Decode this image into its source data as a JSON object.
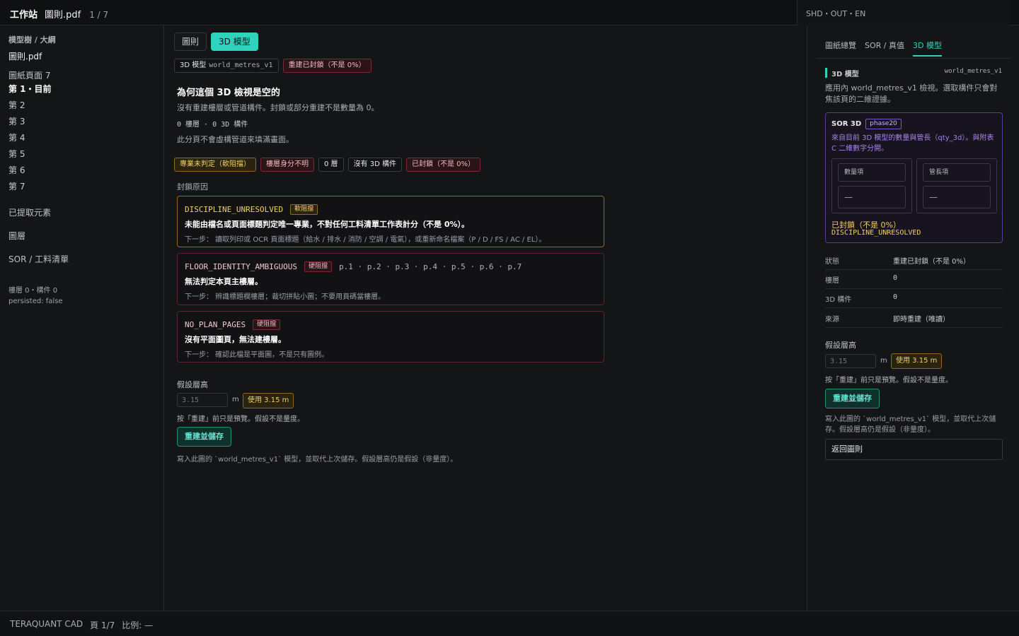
{
  "topbar": {
    "app": "工作站",
    "file": "圖則.pdf",
    "page": "1 / 7",
    "lang": "SHD・OUT・EN"
  },
  "sidebar": {
    "header": "模型樹 / 大綱",
    "file": "圖則.pdf",
    "pages_label": "圖紙頁面 7",
    "pages": [
      "第 1・目前",
      "第 2",
      "第 3",
      "第 4",
      "第 5",
      "第 6",
      "第 7"
    ],
    "extracted": "已提取元素",
    "layers": "圖層",
    "sor": "SOR / 工料清單",
    "meta_counts": "樓層 0・構件 0",
    "meta_persisted": "persisted: false"
  },
  "main": {
    "tabs": [
      "圖則",
      "3D 模型"
    ],
    "model_badge_label": "3D 模型",
    "model_badge_value": "world_metres_v1",
    "locked_badge": "重建已封鎖（不是 0%）",
    "title": "為何這個 3D 檢視是空的",
    "desc1": "沒有重建樓層或管道構件。封鎖或部分重建不是數量為 0。",
    "counts": "0 樓層 · 0 3D 構件",
    "desc2": "此分頁不會虛構管道來填滿畫面。",
    "status_badges": [
      "專業未判定（軟阻擋）",
      "樓層身分不明",
      "0 層",
      "沒有 3D 構件",
      "已封鎖（不是 0%）"
    ],
    "lock_reasons_label": "封鎖原因",
    "reasons": [
      {
        "code": "DISCIPLINE_UNRESOLVED",
        "tag": "軟阻擋",
        "pages": "",
        "message": "未能由檔名或頁面標題判定唯一專業，不對任何工料清單工作表計分（不是 0%）。",
        "next": "下一步： 讀取列印或 OCR 頁面標題（給水 / 排水 / 消防 / 空調 / 電氣），或重新命名檔案（P / D / FS / AC / EL）。"
      },
      {
        "code": "FLOOR_IDENTITY_AMBIGUOUS",
        "tag": "硬阻擋",
        "pages": "p.1 · p.2 · p.3 · p.4 · p.5 · p.6 · p.7",
        "message": "無法判定本頁主樓層。",
        "next": "下一步： 辨識標題欄樓層；裁切拼貼小圖；不要用頁碼當樓層。"
      },
      {
        "code": "NO_PLAN_PAGES",
        "tag": "硬阻擋",
        "pages": "",
        "message": "沒有平面圖頁，無法建樓層。",
        "next": "下一步： 確認此檔是平面圖，不是只有圖例。"
      }
    ],
    "assume_label": "假設層高",
    "height_placeholder": "3.15",
    "unit": "m",
    "use_button": "使用 3.15 m",
    "preview_note": "按「重建」前只是預覽。假設不是量度。",
    "rebuild_button": "重建並儲存",
    "write_note": "寫入此圖的 `world_metres_v1` 模型，並取代上次儲存。假設層高仍是假設（非量度）。"
  },
  "right": {
    "tabs": [
      "圖紙總覽",
      "SOR / 真值",
      "3D 模型"
    ],
    "section_title": "3D 模型",
    "section_model": "world_metres_v1",
    "section_desc": "應用內 world_metres_v1 檢視。選取構件只會對焦該頁的二維證據。",
    "sor_title": "SOR 3D",
    "sor_phase": "phase20",
    "sor_desc": "來自目前 3D 模型的數量與管長（qty_3d）。與附表 C 二維數字分開。",
    "qty_label": "數量項",
    "qty_value": "—",
    "len_label": "管長項",
    "len_value": "—",
    "sor_status": "已封鎖（不是 0%）",
    "sor_code": "DISCIPLINE_UNRESOLVED",
    "kv": [
      {
        "k": "狀態",
        "v": "重建已封鎖（不是 0%）"
      },
      {
        "k": "樓層",
        "v": "0"
      },
      {
        "k": "3D 構件",
        "v": "0"
      },
      {
        "k": "來源",
        "v": "即時重建（唯讀）"
      }
    ],
    "assume_label": "假設層高",
    "height_placeholder": "3.15",
    "unit": "m",
    "use_button": "使用 3.15 m",
    "preview_note": "按「重建」前只是預覽。假設不是量度。",
    "rebuild_button": "重建並儲存",
    "write_note": "寫入此圖的 `world_metres_v1` 模型，並取代上次儲存。假設層高仍是假設（非量度）。",
    "back_button": "返回圖則"
  },
  "footer": {
    "brand": "TERAQUANT CAD",
    "page": "頁 1/7",
    "scale": "比例: —"
  }
}
